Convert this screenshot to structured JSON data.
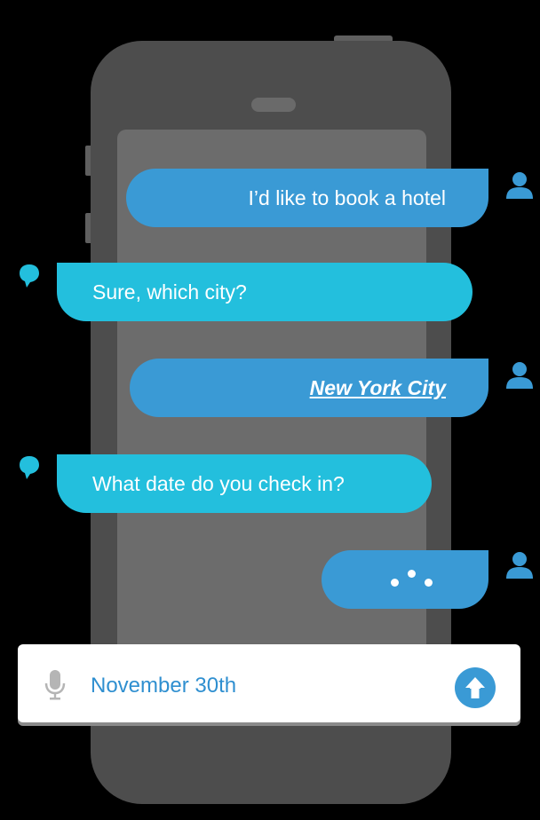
{
  "conversation": {
    "messages": [
      {
        "sender": "user",
        "text": "I’d like to book a hotel"
      },
      {
        "sender": "bot",
        "text": "Sure, which city?"
      },
      {
        "sender": "user",
        "text": "New York City"
      },
      {
        "sender": "bot",
        "text": "What date do you check in?"
      },
      {
        "sender": "user",
        "state": "typing"
      }
    ]
  },
  "composer": {
    "input_value": "November 30th",
    "mic_icon": "microphone-icon",
    "send_icon": "arrow-up-icon"
  },
  "icons": {
    "user_avatar": "user-icon",
    "bot_avatar": "chat-bubble-icon"
  },
  "colors": {
    "background": "#000000",
    "user_bubble": "#3a9ad5",
    "bot_bubble": "#23bfdd",
    "input_text": "#2f8fd0",
    "phone_body": "#4d4d4d"
  }
}
